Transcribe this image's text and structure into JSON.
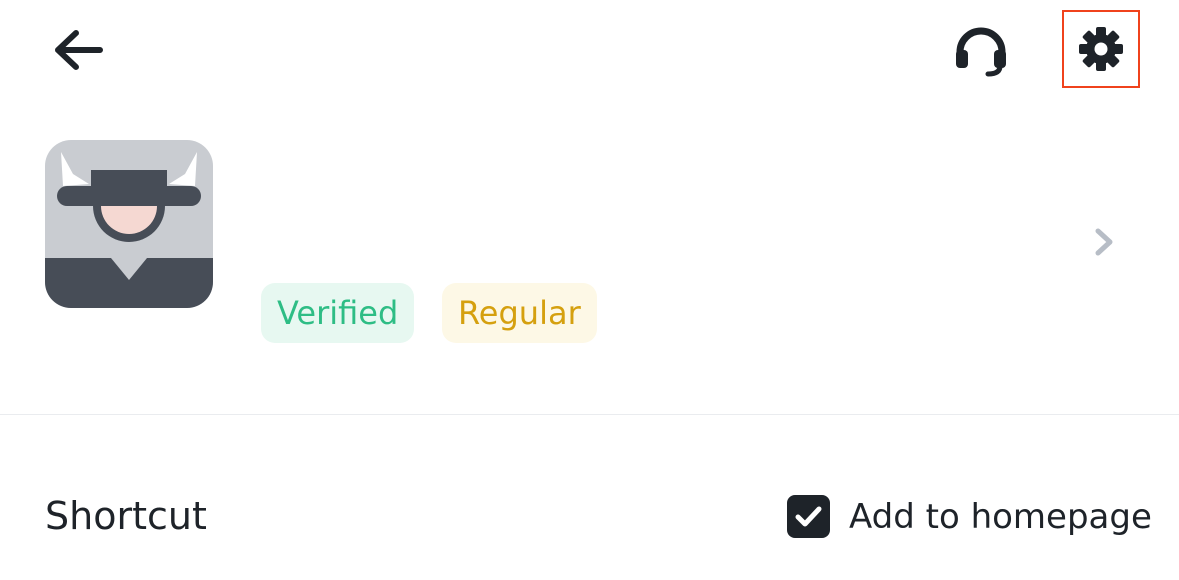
{
  "header": {
    "back_icon": "arrow-left-icon",
    "support_icon": "headset-icon",
    "settings_icon": "gear-icon",
    "settings_highlight_color": "#f0421c"
  },
  "profile": {
    "avatar_icon": "bull-avatar-icon",
    "tags": [
      {
        "label": "Verified",
        "color": "#2ebd85",
        "background": "#e7f8f1"
      },
      {
        "label": "Regular",
        "color": "#d5a00f",
        "background": "#fdf8e6"
      }
    ],
    "chevron_icon": "chevron-right-icon"
  },
  "shortcut": {
    "title": "Shortcut",
    "checkbox_checked": true,
    "checkbox_label": "Add to homepage"
  }
}
